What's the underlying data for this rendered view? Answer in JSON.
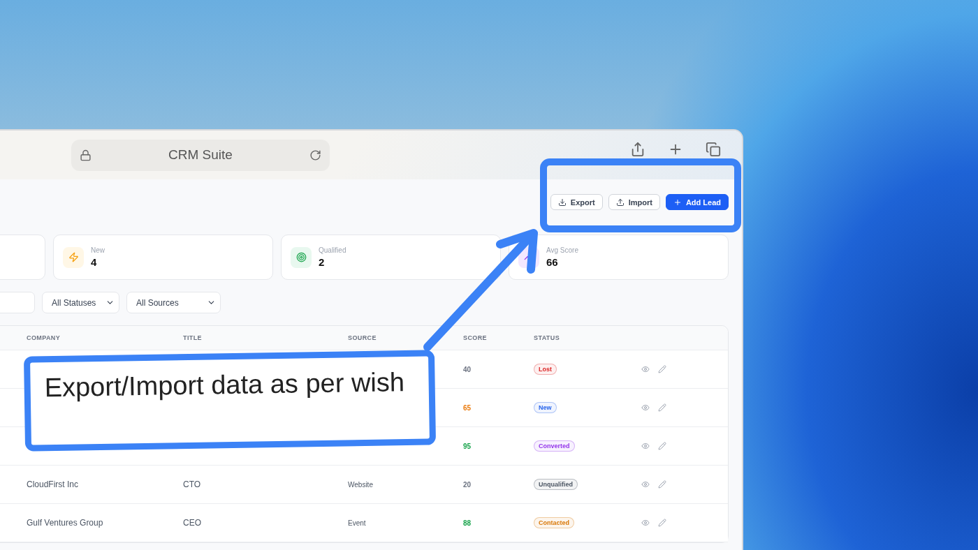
{
  "browser": {
    "address": "CRM Suite"
  },
  "actions": [
    {
      "label": "Export",
      "kind": "export"
    },
    {
      "label": "Import",
      "kind": "import"
    },
    {
      "label": "Add Lead",
      "kind": "add"
    }
  ],
  "stats": [
    {
      "label": "New",
      "value": "4",
      "kind": "new"
    },
    {
      "label": "Qualified",
      "value": "2",
      "kind": "qualified"
    },
    {
      "label": "Avg Score",
      "value": "66",
      "kind": "score"
    }
  ],
  "filters": [
    {
      "value": "All Statuses"
    },
    {
      "value": "All Sources"
    }
  ],
  "table": {
    "columns": [
      "COMPANY",
      "TITLE",
      "SOURCE",
      "SCORE",
      "STATUS"
    ],
    "rows": [
      {
        "score": {
          "text": "40",
          "color": "#6b7280"
        },
        "status": {
          "label": "Lost",
          "color": "#dc2626"
        }
      },
      {
        "score": {
          "text": "65",
          "color": "#ea7a0c"
        },
        "status": {
          "label": "New",
          "color": "#2563eb"
        }
      },
      {
        "score": {
          "text": "95",
          "color": "#16a34a"
        },
        "status": {
          "label": "Converted",
          "color": "#9333ea"
        }
      },
      {
        "company": "CloudFirst Inc",
        "title": "CTO",
        "source": "Website",
        "score": {
          "text": "20",
          "color": "#6b7280"
        },
        "status": {
          "label": "Unqualified",
          "color": "#4b5563"
        }
      },
      {
        "company": "Gulf Ventures Group",
        "title": "CEO",
        "source": "Event",
        "score": {
          "text": "88",
          "color": "#16a34a"
        },
        "status": {
          "label": "Contacted",
          "color": "#d97706"
        }
      }
    ]
  },
  "callout": {
    "text": "Export/Import data as per wish"
  }
}
